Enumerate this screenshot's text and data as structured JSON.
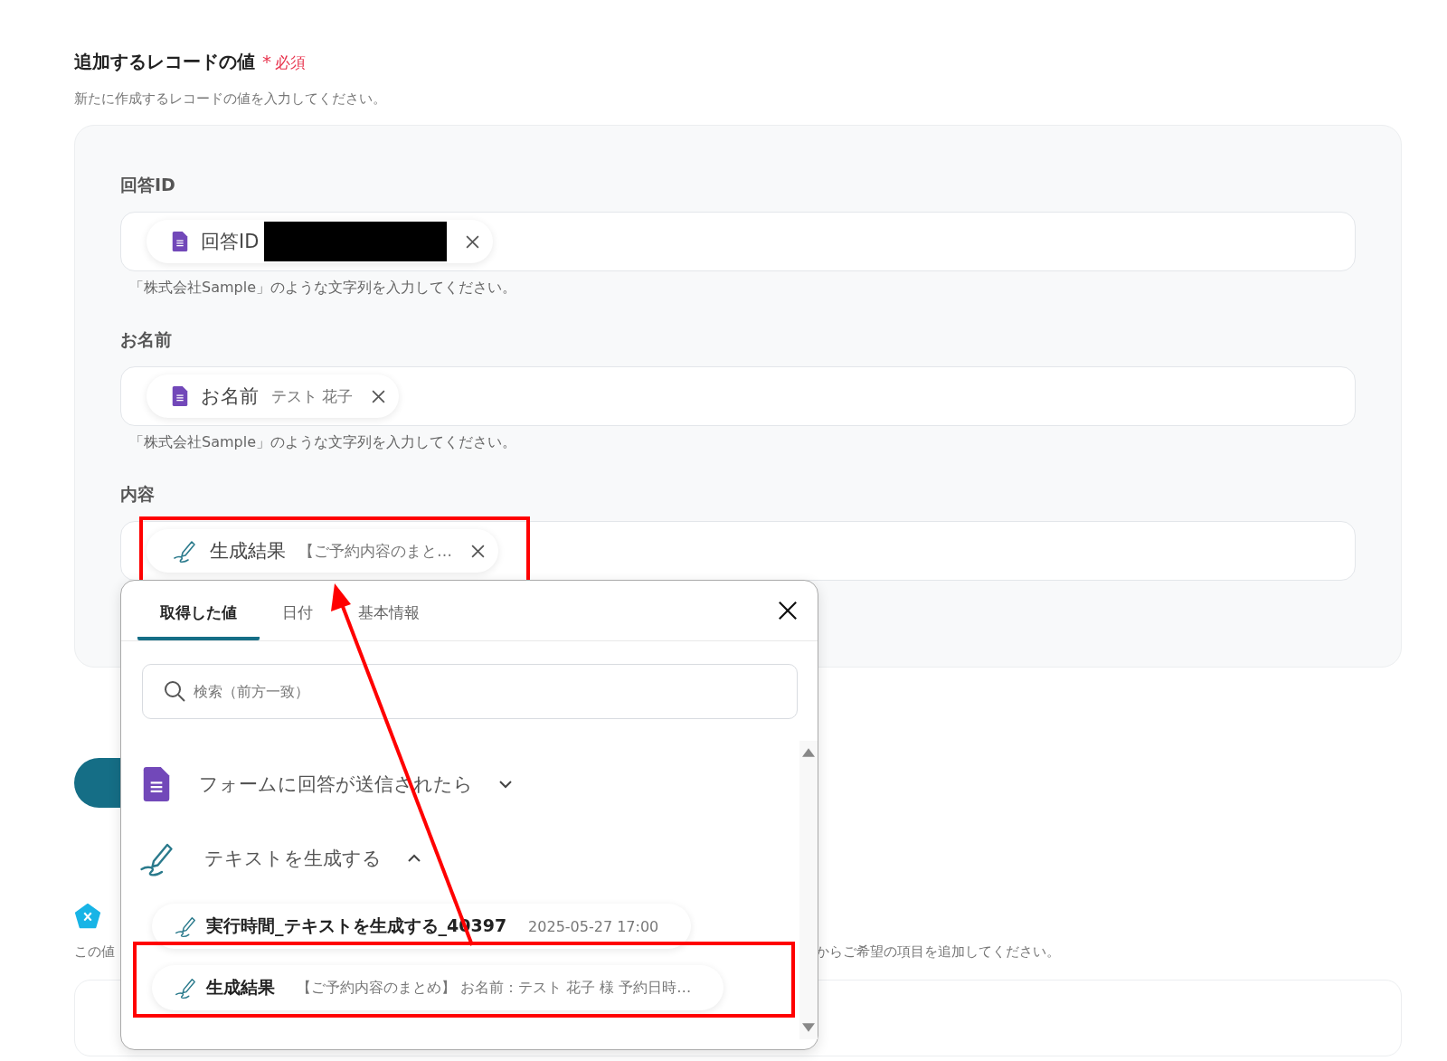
{
  "section": {
    "title": "追加するレコードの値",
    "required_mark": "*",
    "required_label": "必須",
    "description": "新たに作成するレコードの値を入力してください。"
  },
  "fields": [
    {
      "label": "回答ID",
      "chip": {
        "kind": "form",
        "name": "回答ID",
        "redacted": true
      },
      "hint": "「株式会社Sample」のような文字列を入力してください。"
    },
    {
      "label": "お名前",
      "chip": {
        "kind": "form",
        "name": "お名前",
        "value": "テスト 花子",
        "redacted": false
      },
      "hint": "「株式会社Sample」のような文字列を入力してください。"
    },
    {
      "label": "内容",
      "chip": {
        "kind": "text",
        "name": "生成結果",
        "value": "【ご予約内容のまと…",
        "redacted": false
      },
      "highlighted": true
    }
  ],
  "next_section": {
    "description_start": "この値",
    "description_end": "からご希望の項目を追加してください。"
  },
  "picker": {
    "tabs": [
      {
        "label": "取得した値",
        "selected": true
      },
      {
        "label": "日付",
        "selected": false
      },
      {
        "label": "基本情報",
        "selected": false
      }
    ],
    "search": {
      "placeholder": "検索（前方一致）"
    },
    "groups": [
      {
        "kind": "form",
        "title": "フォームに回答が送信されたら",
        "expanded": false
      },
      {
        "kind": "text",
        "title": "テキストを生成する",
        "expanded": true,
        "items": [
          {
            "name": "実行時間_テキストを生成する_40397",
            "value": "2025-05-27 17:00",
            "highlighted": false
          },
          {
            "name": "生成結果",
            "value": "【ご予約内容のまとめ】 お名前：テスト 花子 様 予約日時…",
            "highlighted": true
          }
        ]
      }
    ]
  },
  "annotation": {
    "arrow": true
  }
}
